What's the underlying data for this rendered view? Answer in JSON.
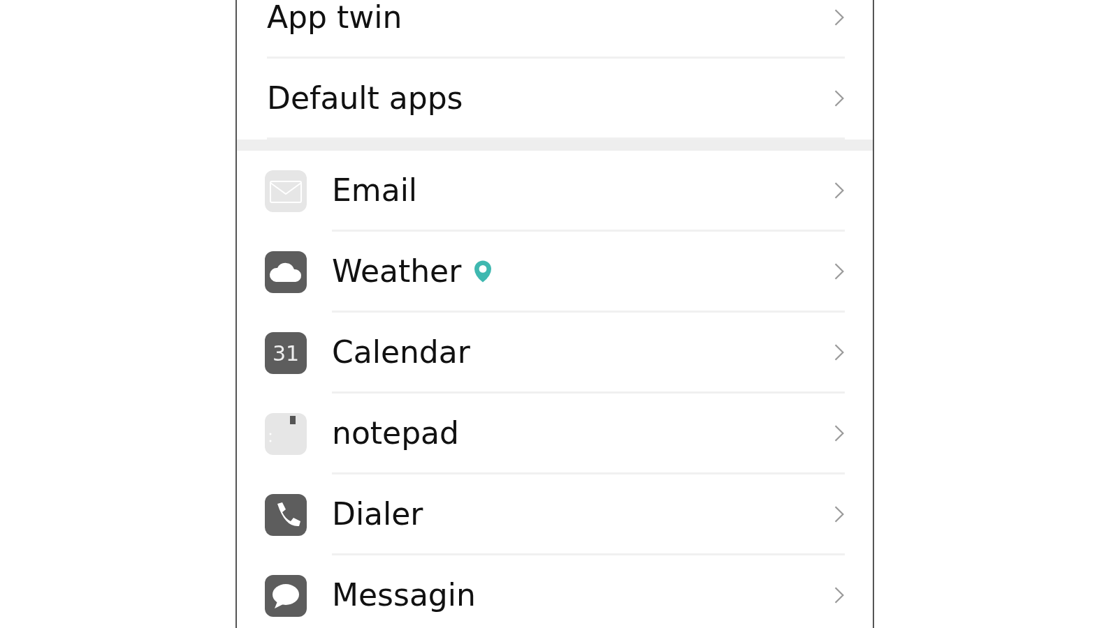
{
  "sections": [
    {
      "kind": "plain",
      "items": [
        {
          "label": "App twin",
          "location_pin": false
        },
        {
          "label": "Default apps",
          "location_pin": false
        }
      ]
    },
    {
      "kind": "apps",
      "items": [
        {
          "label": "Email",
          "location_pin": false
        },
        {
          "label": "Weather",
          "location_pin": true
        },
        {
          "label": "Calendar",
          "location_pin": false,
          "icon_text": "31"
        },
        {
          "label": "notepad",
          "location_pin": false
        },
        {
          "label": "Dialer",
          "location_pin": false
        },
        {
          "label": "Messagin",
          "location_pin": false
        }
      ]
    }
  ]
}
